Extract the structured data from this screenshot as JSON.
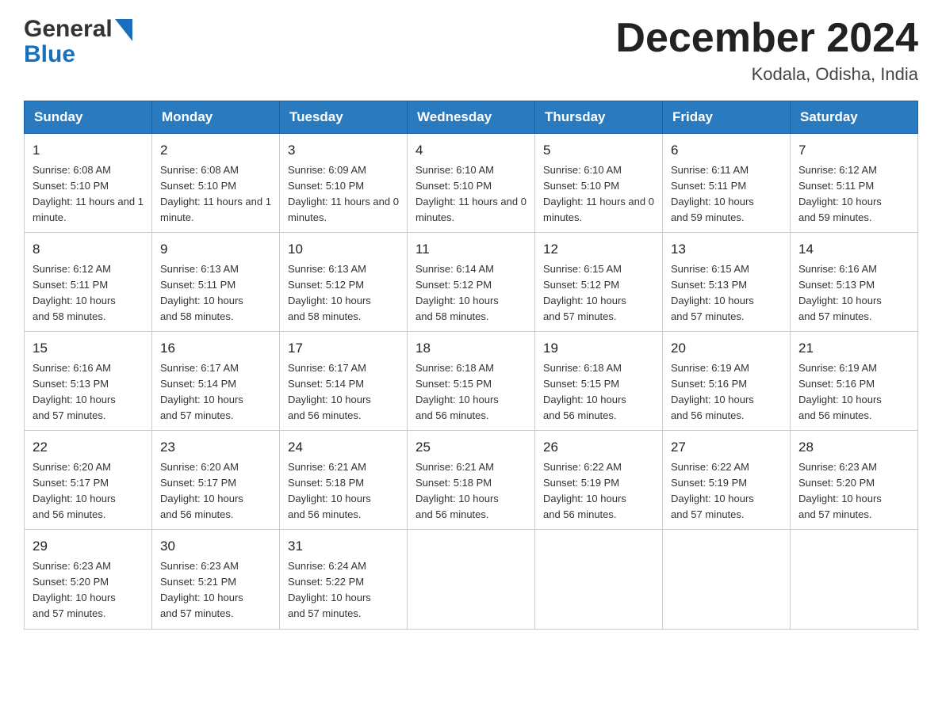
{
  "header": {
    "logo_general": "General",
    "logo_blue": "Blue",
    "month_title": "December 2024",
    "location": "Kodala, Odisha, India"
  },
  "days_of_week": [
    "Sunday",
    "Monday",
    "Tuesday",
    "Wednesday",
    "Thursday",
    "Friday",
    "Saturday"
  ],
  "weeks": [
    [
      {
        "day": "1",
        "sunrise": "6:08 AM",
        "sunset": "5:10 PM",
        "daylight": "11 hours and 1 minute."
      },
      {
        "day": "2",
        "sunrise": "6:08 AM",
        "sunset": "5:10 PM",
        "daylight": "11 hours and 1 minute."
      },
      {
        "day": "3",
        "sunrise": "6:09 AM",
        "sunset": "5:10 PM",
        "daylight": "11 hours and 0 minutes."
      },
      {
        "day": "4",
        "sunrise": "6:10 AM",
        "sunset": "5:10 PM",
        "daylight": "11 hours and 0 minutes."
      },
      {
        "day": "5",
        "sunrise": "6:10 AM",
        "sunset": "5:10 PM",
        "daylight": "11 hours and 0 minutes."
      },
      {
        "day": "6",
        "sunrise": "6:11 AM",
        "sunset": "5:11 PM",
        "daylight": "10 hours and 59 minutes."
      },
      {
        "day": "7",
        "sunrise": "6:12 AM",
        "sunset": "5:11 PM",
        "daylight": "10 hours and 59 minutes."
      }
    ],
    [
      {
        "day": "8",
        "sunrise": "6:12 AM",
        "sunset": "5:11 PM",
        "daylight": "10 hours and 58 minutes."
      },
      {
        "day": "9",
        "sunrise": "6:13 AM",
        "sunset": "5:11 PM",
        "daylight": "10 hours and 58 minutes."
      },
      {
        "day": "10",
        "sunrise": "6:13 AM",
        "sunset": "5:12 PM",
        "daylight": "10 hours and 58 minutes."
      },
      {
        "day": "11",
        "sunrise": "6:14 AM",
        "sunset": "5:12 PM",
        "daylight": "10 hours and 58 minutes."
      },
      {
        "day": "12",
        "sunrise": "6:15 AM",
        "sunset": "5:12 PM",
        "daylight": "10 hours and 57 minutes."
      },
      {
        "day": "13",
        "sunrise": "6:15 AM",
        "sunset": "5:13 PM",
        "daylight": "10 hours and 57 minutes."
      },
      {
        "day": "14",
        "sunrise": "6:16 AM",
        "sunset": "5:13 PM",
        "daylight": "10 hours and 57 minutes."
      }
    ],
    [
      {
        "day": "15",
        "sunrise": "6:16 AM",
        "sunset": "5:13 PM",
        "daylight": "10 hours and 57 minutes."
      },
      {
        "day": "16",
        "sunrise": "6:17 AM",
        "sunset": "5:14 PM",
        "daylight": "10 hours and 57 minutes."
      },
      {
        "day": "17",
        "sunrise": "6:17 AM",
        "sunset": "5:14 PM",
        "daylight": "10 hours and 56 minutes."
      },
      {
        "day": "18",
        "sunrise": "6:18 AM",
        "sunset": "5:15 PM",
        "daylight": "10 hours and 56 minutes."
      },
      {
        "day": "19",
        "sunrise": "6:18 AM",
        "sunset": "5:15 PM",
        "daylight": "10 hours and 56 minutes."
      },
      {
        "day": "20",
        "sunrise": "6:19 AM",
        "sunset": "5:16 PM",
        "daylight": "10 hours and 56 minutes."
      },
      {
        "day": "21",
        "sunrise": "6:19 AM",
        "sunset": "5:16 PM",
        "daylight": "10 hours and 56 minutes."
      }
    ],
    [
      {
        "day": "22",
        "sunrise": "6:20 AM",
        "sunset": "5:17 PM",
        "daylight": "10 hours and 56 minutes."
      },
      {
        "day": "23",
        "sunrise": "6:20 AM",
        "sunset": "5:17 PM",
        "daylight": "10 hours and 56 minutes."
      },
      {
        "day": "24",
        "sunrise": "6:21 AM",
        "sunset": "5:18 PM",
        "daylight": "10 hours and 56 minutes."
      },
      {
        "day": "25",
        "sunrise": "6:21 AM",
        "sunset": "5:18 PM",
        "daylight": "10 hours and 56 minutes."
      },
      {
        "day": "26",
        "sunrise": "6:22 AM",
        "sunset": "5:19 PM",
        "daylight": "10 hours and 56 minutes."
      },
      {
        "day": "27",
        "sunrise": "6:22 AM",
        "sunset": "5:19 PM",
        "daylight": "10 hours and 57 minutes."
      },
      {
        "day": "28",
        "sunrise": "6:23 AM",
        "sunset": "5:20 PM",
        "daylight": "10 hours and 57 minutes."
      }
    ],
    [
      {
        "day": "29",
        "sunrise": "6:23 AM",
        "sunset": "5:20 PM",
        "daylight": "10 hours and 57 minutes."
      },
      {
        "day": "30",
        "sunrise": "6:23 AM",
        "sunset": "5:21 PM",
        "daylight": "10 hours and 57 minutes."
      },
      {
        "day": "31",
        "sunrise": "6:24 AM",
        "sunset": "5:22 PM",
        "daylight": "10 hours and 57 minutes."
      },
      null,
      null,
      null,
      null
    ]
  ],
  "labels": {
    "sunrise": "Sunrise:",
    "sunset": "Sunset:",
    "daylight": "Daylight:"
  }
}
